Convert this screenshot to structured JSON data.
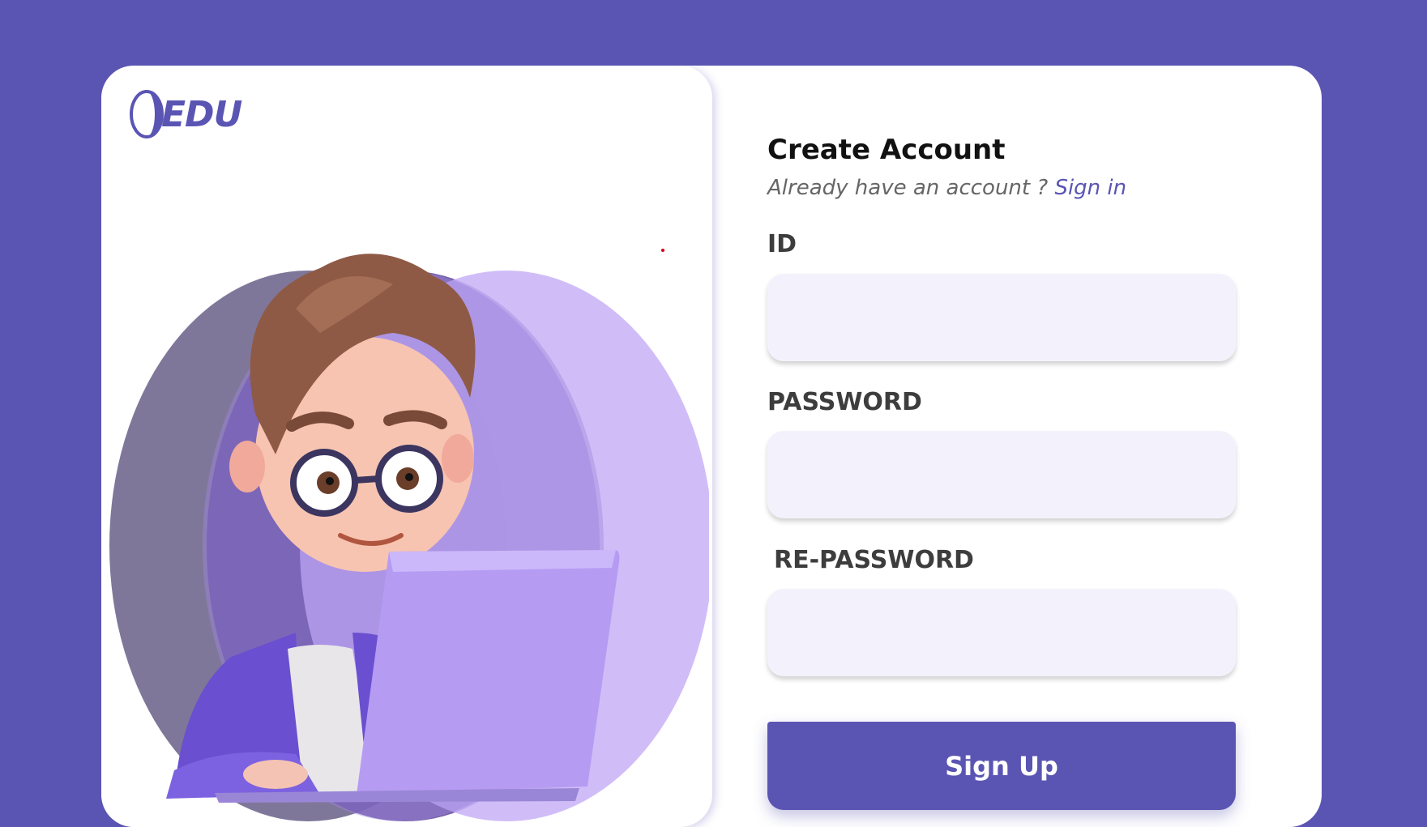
{
  "brand": {
    "name": "EDU",
    "color": "#5a55b3"
  },
  "form": {
    "title": "Create Account",
    "subtitle_text": "Already have an account ? ",
    "sign_in_link": "Sign in",
    "id_label": "ID",
    "id_value": "",
    "password_label": "PASSWORD",
    "password_value": "",
    "repassword_label": "RE-PASSWORD",
    "repassword_value": "",
    "submit_label": "Sign Up"
  },
  "colors": {
    "background": "#5a55b3",
    "input_fill": "#f3f2fc",
    "accent": "#5a55b3"
  }
}
